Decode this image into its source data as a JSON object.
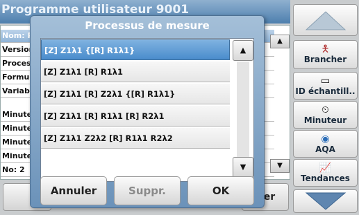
{
  "background": {
    "title": "Programme utilisateur 9001",
    "rows": [
      "Nom: P",
      "Version",
      "Processus",
      "Formule",
      "Variable",
      "Minuteur",
      "Minuteur",
      "Minuteur",
      "Minuteur",
      "No: 2"
    ],
    "bottom_left": "Qu",
    "bottom_right": "istrer"
  },
  "right_panel": {
    "brancher": "Brancher",
    "id_echantillon": "ID échantill..",
    "minuteur": "Minuteur",
    "aqa": "AQA",
    "tendances": "Tendances"
  },
  "dialog": {
    "title": "Processus de mesure",
    "items": [
      "[Z] Z1λ1 {[R] R1λ1}",
      "[Z] Z1λ1 [R] R1λ1",
      "[Z] Z1λ1 [R] Z2λ1 {[R] R1λ1}",
      "[Z] Z1λ1 [R] R1λ1 [R] R2λ1",
      "[Z] Z1λ1 Z2λ2 [R] R1λ1 R2λ2"
    ],
    "cancel_label": "Annuler",
    "delete_label": "Suppr.",
    "ok_label": "OK"
  },
  "colors": {
    "title_bar": "#4d7fae",
    "selected_row": "#4a8ccc",
    "disabled_text": "#8a8a8a"
  }
}
